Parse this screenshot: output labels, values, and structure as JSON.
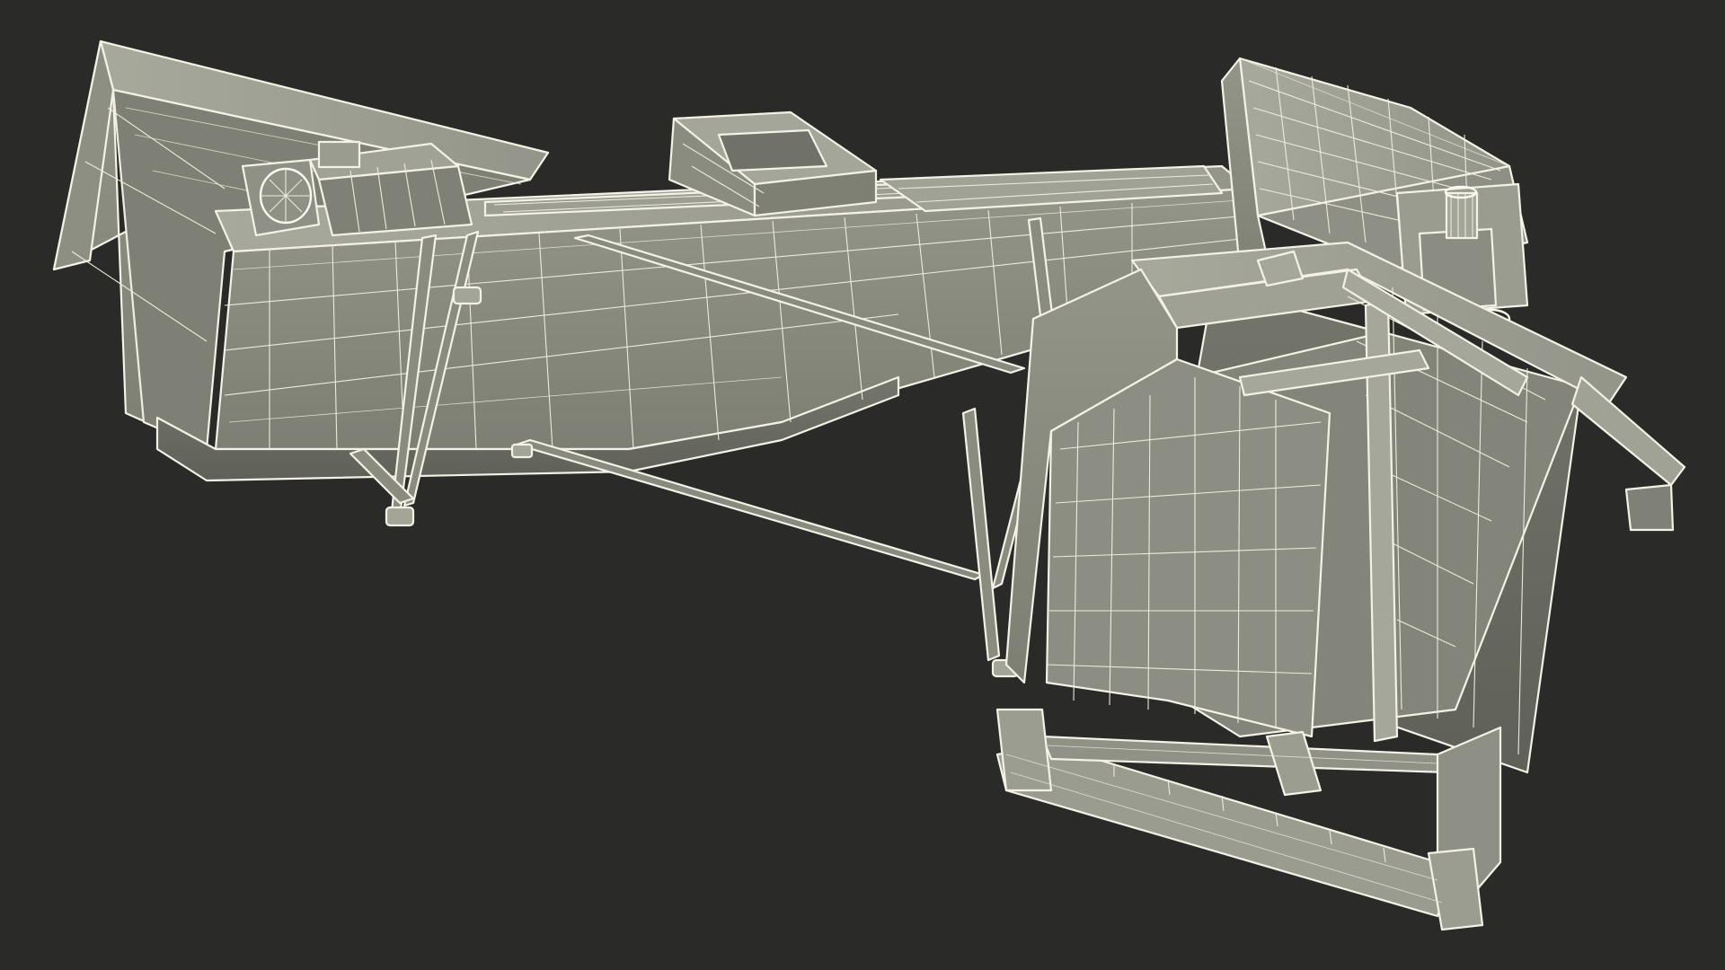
{
  "scene": {
    "subject": "",
    "colors": {
      "background": "#2a2a28",
      "surface": "#8a8c80",
      "surface_light": "#a2a498",
      "surface_dark": "#6b6d63",
      "wire": "#f2f1e4"
    }
  }
}
